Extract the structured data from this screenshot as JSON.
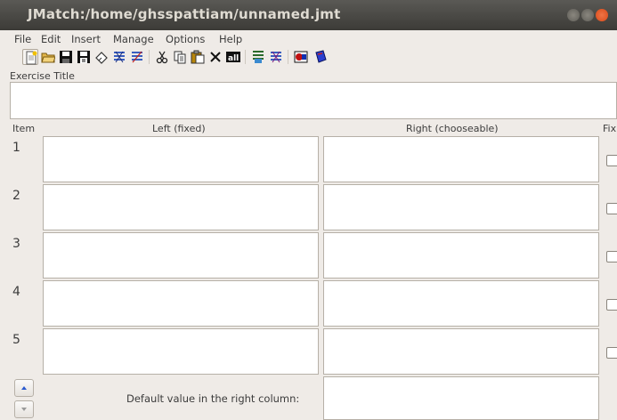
{
  "window": {
    "title": "JMatch:/home/ghsspattiam/unnamed.jmt"
  },
  "menu": {
    "items": [
      "File",
      "Edit",
      "Insert",
      "Manage",
      "Options",
      "Help"
    ]
  },
  "toolbar": {
    "buttons": [
      {
        "icon": "new-file-icon"
      },
      {
        "icon": "open-folder-icon"
      },
      {
        "icon": "save-icon"
      },
      {
        "icon": "save-as-icon"
      },
      {
        "icon": "eraser-icon"
      },
      {
        "icon": "shuffle-icon"
      },
      {
        "icon": "shuffle-alt-icon"
      },
      {
        "icon": "cut-icon"
      },
      {
        "icon": "copy-icon"
      },
      {
        "icon": "paste-icon"
      },
      {
        "icon": "delete-icon"
      },
      {
        "icon": "select-all-icon"
      },
      {
        "icon": "export-icon"
      },
      {
        "icon": "export-alt-icon"
      },
      {
        "icon": "config-icon"
      },
      {
        "icon": "help-book-icon"
      }
    ]
  },
  "form": {
    "exercise_title_label": "Exercise Title",
    "exercise_title_value": "",
    "columns": {
      "item": "Item",
      "left": "Left (fixed)",
      "right": "Right (chooseable)",
      "fix": "Fix"
    },
    "rows": [
      {
        "num": "1",
        "left": "",
        "right": "",
        "fixed": false
      },
      {
        "num": "2",
        "left": "",
        "right": "",
        "fixed": false
      },
      {
        "num": "3",
        "left": "",
        "right": "",
        "fixed": false
      },
      {
        "num": "4",
        "left": "",
        "right": "",
        "fixed": false
      },
      {
        "num": "5",
        "left": "",
        "right": "",
        "fixed": false
      }
    ],
    "default_label": "Default value in the right column:",
    "default_value": ""
  },
  "colors": {
    "titlebar": "#3c3b37",
    "close": "#e9541f",
    "field_bg": "#ffffff",
    "window_bg": "#efebe7"
  }
}
